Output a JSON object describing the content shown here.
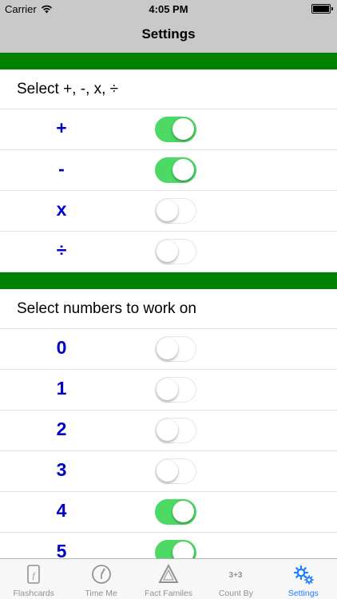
{
  "status_bar": {
    "carrier": "Carrier",
    "time": "4:05 PM"
  },
  "nav": {
    "title": "Settings"
  },
  "colors": {
    "accent_bar": "#008000",
    "toggle_on": "#4cd964",
    "label_blue": "#0000c8",
    "tab_active": "#1b7cff"
  },
  "operations": {
    "header": "Select +, -, x, ÷",
    "items": [
      {
        "label": "+",
        "on": true
      },
      {
        "label": "-",
        "on": true
      },
      {
        "label": "x",
        "on": false
      },
      {
        "label": "÷",
        "on": false
      }
    ]
  },
  "numbers": {
    "header": "Select numbers to work on",
    "items": [
      {
        "label": "0",
        "on": false
      },
      {
        "label": "1",
        "on": false
      },
      {
        "label": "2",
        "on": false
      },
      {
        "label": "3",
        "on": false
      },
      {
        "label": "4",
        "on": true
      },
      {
        "label": "5",
        "on": true
      }
    ]
  },
  "tabs": [
    {
      "label": "Flashcards",
      "icon": "flashcard-icon",
      "active": false
    },
    {
      "label": "Time Me",
      "icon": "stopwatch-icon",
      "active": false
    },
    {
      "label": "Fact Familes",
      "icon": "triangle-icon",
      "active": false
    },
    {
      "label": "Count By",
      "icon": "count-by-icon",
      "icon_text": "3+3",
      "active": false
    },
    {
      "label": "Settings",
      "icon": "gears-icon",
      "active": true
    }
  ]
}
